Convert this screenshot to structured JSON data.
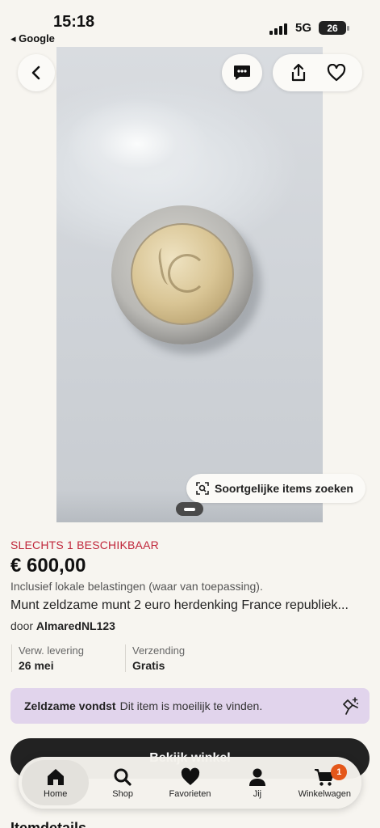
{
  "status_bar": {
    "time": "15:18",
    "back_app": "◂ Google",
    "network": "5G",
    "battery": "26"
  },
  "photo": {
    "similar_button_label": "Soortgelijke items zoeken",
    "icons": [
      "back-icon",
      "message-icon",
      "share-icon",
      "heart-icon",
      "image-search-icon"
    ]
  },
  "listing": {
    "availability": "SLECHTS 1 BESCHIKBAAR",
    "price": "€ 600,00",
    "tax_note": "Inclusief lokale belastingen (waar van toepassing).",
    "title": "Munt zeldzame munt 2 euro herdenking France republiek...",
    "seller_prefix": "door",
    "seller_name": "AlmaredNL123",
    "delivery_label": "Verw. levering",
    "delivery_value": "26 mei",
    "shipping_label": "Verzending",
    "shipping_value": "Gratis"
  },
  "banner": {
    "title": "Zeldzame vondst",
    "text": "Dit item is moeilijk te vinden.",
    "icon": "diamond-sparkle-icon"
  },
  "buy_button_label": "Bekijk winkel",
  "section_title": "Itemdetails",
  "tab_bar": {
    "tabs": [
      {
        "label": "Home",
        "icon": "home-icon",
        "active": true
      },
      {
        "label": "Shop",
        "icon": "search-icon"
      },
      {
        "label": "Favorieten",
        "icon": "heart-icon"
      },
      {
        "label": "Jij",
        "icon": "person-icon"
      },
      {
        "label": "Winkelwagen",
        "icon": "cart-icon",
        "badge": "1"
      }
    ]
  },
  "colors": {
    "availability": "#c0273b",
    "banner_bg": "#e1d4ec",
    "badge": "#e4571a",
    "button_dark": "#222222"
  }
}
